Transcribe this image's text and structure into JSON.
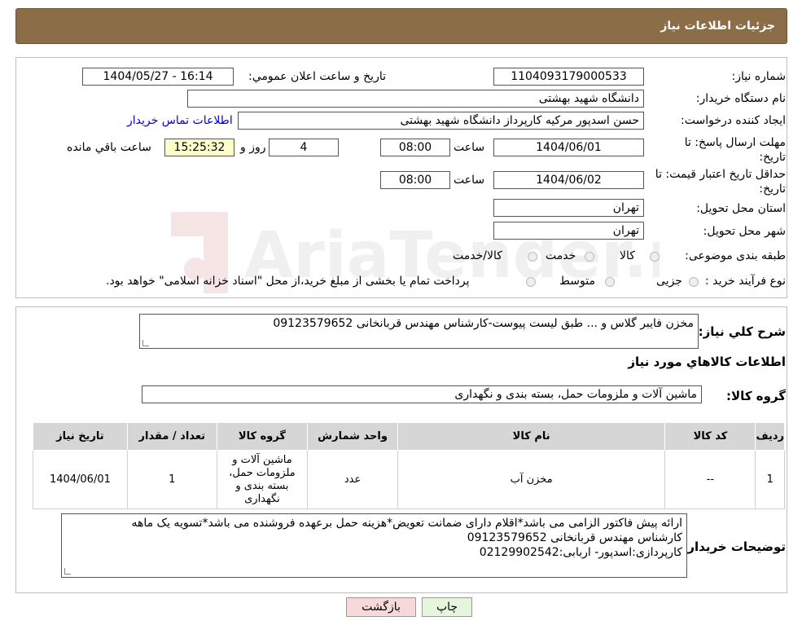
{
  "header": {
    "title": "جزئیات اطلاعات نیاز"
  },
  "labels": {
    "need_number": "شماره نیاز:",
    "announce_datetime": "تاریخ و ساعت اعلان عمومي:",
    "buyer_org": "نام دستگاه خریدار:",
    "requester": "ایجاد کننده درخواست:",
    "contact_link": "اطلاعات تماس خریدار",
    "reply_deadline": "مهلت ارسال پاسخ: تا تاریخ:",
    "time_word": "ساعت",
    "days_word": "روز و",
    "remaining_word": "ساعت باقي مانده",
    "price_validity": "حداقل تاریخ اعتبار قیمت: تا تاریخ:",
    "delivery_province": "استان محل تحویل:",
    "delivery_city": "شهر محل تحویل:",
    "category": "طبقه بندی موضوعی:",
    "purchase_process": "نوع فرآیند خرید :",
    "general_desc": "شرح كلي نیاز:",
    "goods_info": "اطلاعات كالاهاي مورد نیاز",
    "goods_group": "گروه کالا:",
    "buyer_notes": "توضیحات خریدار:"
  },
  "values": {
    "need_number": "1104093179000533",
    "announce_datetime": "1404/05/27 - 16:14",
    "buyer_org": "دانشگاه شهید بهشتی",
    "requester": "حسن اسدپور مرکیه کارپرداز دانشگاه شهید بهشتی",
    "reply_date": "1404/06/01",
    "reply_time": "08:00",
    "days": "4",
    "remaining_time": "15:25:32",
    "validity_date": "1404/06/02",
    "validity_time": "08:00",
    "province": "تهران",
    "city": "تهران",
    "general_desc": "مخزن فایبر گلاس و ... طبق لیست پیوست-کارشناس مهندس قربانخانی 09123579652",
    "goods_group": "ماشین آلات و ملزومات حمل، بسته بندی و نگهداری",
    "buyer_notes_1": "ارائه پیش فاکتور الزامی می باشد*اقلام دارای ضمانت تعویض*هزینه حمل برعهده فروشنده می باشد*تسویه یک ماهه",
    "buyer_notes_2": "کارشناس مهندس قربانخانی 09123579652",
    "buyer_notes_3": "کارپردازی:اسدپور- اربابی:02129902542"
  },
  "category_options": [
    "کالا",
    "خدمت",
    "کالا/خدمت"
  ],
  "process_options": [
    "جزیی",
    "متوسط",
    "پرداخت تمام یا بخشی از مبلغ خرید،از محل \"اسناد خزانه اسلامی\" خواهد بود."
  ],
  "table": {
    "headers": [
      "ردیف",
      "کد کالا",
      "نام کالا",
      "واحد شمارش",
      "گروه کالا",
      "تعداد / مقدار",
      "تاریخ نیاز"
    ],
    "rows": [
      {
        "row": "1",
        "code": "--",
        "name": "مخزن آب",
        "unit": "عدد",
        "group": "ماشین آلات و ملزومات حمل، بسته بندی و نگهداری",
        "qty": "1",
        "date": "1404/06/01"
      }
    ]
  },
  "buttons": {
    "print": "چاپ",
    "back": "بازگشت"
  },
  "watermark": {
    "text": "AriaTender.neT"
  },
  "colors": {
    "header_bg": "#8b6d48",
    "back_btn": "#f7d9d9",
    "print_btn": "#e6f5dc",
    "timer_bg": "#ffffc8",
    "link": "#0000cc"
  }
}
